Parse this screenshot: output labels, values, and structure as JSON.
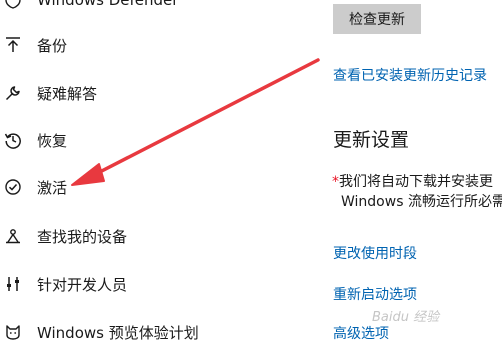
{
  "sidebar": {
    "items": [
      {
        "label": "Windows Defender",
        "icon": "shield-icon"
      },
      {
        "label": "备份",
        "icon": "backup-arrow-icon"
      },
      {
        "label": "疑难解答",
        "icon": "wrench-icon"
      },
      {
        "label": "恢复",
        "icon": "history-icon"
      },
      {
        "label": "激活",
        "icon": "check-circle-icon"
      },
      {
        "label": "查找我的设备",
        "icon": "find-device-icon"
      },
      {
        "label": "针对开发人员",
        "icon": "developer-tools-icon"
      },
      {
        "label": "Windows 预览体验计划",
        "icon": "insider-cat-icon"
      }
    ]
  },
  "main": {
    "check_button": "检查更新",
    "history_link": "查看已安装更新历史记录",
    "settings_title": "更新设置",
    "desc_asterisk": "*",
    "desc_line1": "我们将自动下载并安装更",
    "desc_line2": "Windows 流畅运行所必需",
    "links": [
      "更改使用时段",
      "重新启动选项",
      "高级选项"
    ]
  },
  "watermark": "Baidu 经验",
  "colors": {
    "link": "#0063b1",
    "button_bg": "#cccccc",
    "annotation_arrow": "#e8393f"
  }
}
